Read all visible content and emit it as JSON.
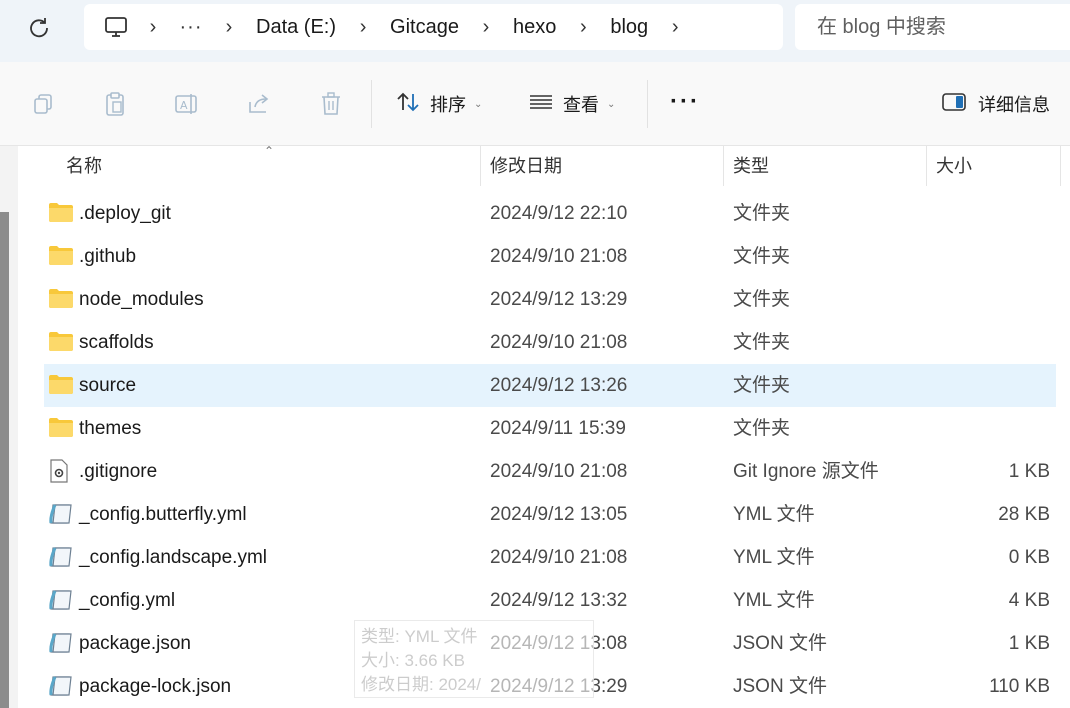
{
  "address_bar": {
    "breadcrumbs": [
      "Data (E:)",
      "Gitcage",
      "hexo",
      "blog"
    ],
    "more": "···",
    "separator": "›"
  },
  "search": {
    "placeholder": "在 blog 中搜索"
  },
  "toolbar": {
    "sort_label": "排序",
    "view_label": "查看",
    "more_label": "···",
    "details_label": "详细信息"
  },
  "columns": {
    "name": "名称",
    "modified": "修改日期",
    "type": "类型",
    "size": "大小"
  },
  "files": [
    {
      "name": ".deploy_git",
      "modified": "2024/9/12 22:10",
      "type": "文件夹",
      "size": "",
      "icon": "folder-icon"
    },
    {
      "name": ".github",
      "modified": "2024/9/10 21:08",
      "type": "文件夹",
      "size": "",
      "icon": "folder-icon"
    },
    {
      "name": "node_modules",
      "modified": "2024/9/12 13:29",
      "type": "文件夹",
      "size": "",
      "icon": "folder-icon"
    },
    {
      "name": "scaffolds",
      "modified": "2024/9/10 21:08",
      "type": "文件夹",
      "size": "",
      "icon": "folder-icon"
    },
    {
      "name": "source",
      "modified": "2024/9/12 13:26",
      "type": "文件夹",
      "size": "",
      "icon": "folder-icon",
      "selected": true
    },
    {
      "name": "themes",
      "modified": "2024/9/11 15:39",
      "type": "文件夹",
      "size": "",
      "icon": "folder-icon"
    },
    {
      "name": ".gitignore",
      "modified": "2024/9/10 21:08",
      "type": "Git Ignore 源文件",
      "size": "1 KB",
      "icon": "settings-file-icon"
    },
    {
      "name": "_config.butterfly.yml",
      "modified": "2024/9/12 13:05",
      "type": "YML 文件",
      "size": "28 KB",
      "icon": "text-file-icon"
    },
    {
      "name": "_config.landscape.yml",
      "modified": "2024/9/10 21:08",
      "type": "YML 文件",
      "size": "0 KB",
      "icon": "text-file-icon"
    },
    {
      "name": "_config.yml",
      "modified": "2024/9/12 13:32",
      "type": "YML 文件",
      "size": "4 KB",
      "icon": "text-file-icon"
    },
    {
      "name": "package.json",
      "modified": "2024/9/12 13:08",
      "type": "JSON 文件",
      "size": "1 KB",
      "icon": "text-file-icon"
    },
    {
      "name": "package-lock.json",
      "modified": "2024/9/12 13:29",
      "type": "JSON 文件",
      "size": "110 KB",
      "icon": "text-file-icon"
    }
  ],
  "tooltip": {
    "line1": "类型: YML 文件",
    "line2": "大小: 3.66 KB",
    "line3": "修改日期: 2024/"
  },
  "colors": {
    "addressbar_bg": "#eff4f9",
    "selected_row": "#e5f3fd",
    "folder": "#f8c83a",
    "accent": "#1f6fb5"
  }
}
